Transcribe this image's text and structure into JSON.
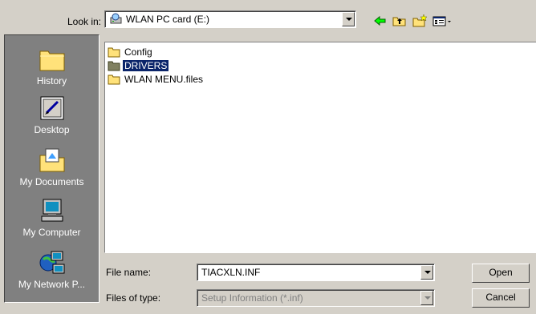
{
  "look_in": {
    "label": "Look in:",
    "value": "WLAN PC card (E:)",
    "icon": "drive-icon"
  },
  "toolbar": {
    "back_icon": "back-arrow-icon",
    "up_icon": "up-folder-icon",
    "new_folder_icon": "new-folder-icon",
    "view_icon": "view-menu-icon"
  },
  "places": [
    {
      "label": "History",
      "icon": "history-folder-icon"
    },
    {
      "label": "Desktop",
      "icon": "desktop-icon"
    },
    {
      "label": "My Documents",
      "icon": "my-documents-icon"
    },
    {
      "label": "My Computer",
      "icon": "my-computer-icon"
    },
    {
      "label": "My Network P...",
      "icon": "network-places-icon"
    }
  ],
  "files": [
    {
      "name": "Config",
      "selected": false
    },
    {
      "name": "DRIVERS",
      "selected": true
    },
    {
      "name": "WLAN MENU.files",
      "selected": false
    }
  ],
  "file_name": {
    "label": "File name:",
    "value": "TIACXLN.INF"
  },
  "file_type": {
    "label": "Files of type:",
    "value": "Setup Information (*.inf)"
  },
  "buttons": {
    "open": "Open",
    "cancel": "Cancel"
  },
  "colors": {
    "dialog_bg": "#d4d0c8",
    "places_bg": "#808080",
    "selection": "#0a246a",
    "folder": "#ffe27a"
  }
}
